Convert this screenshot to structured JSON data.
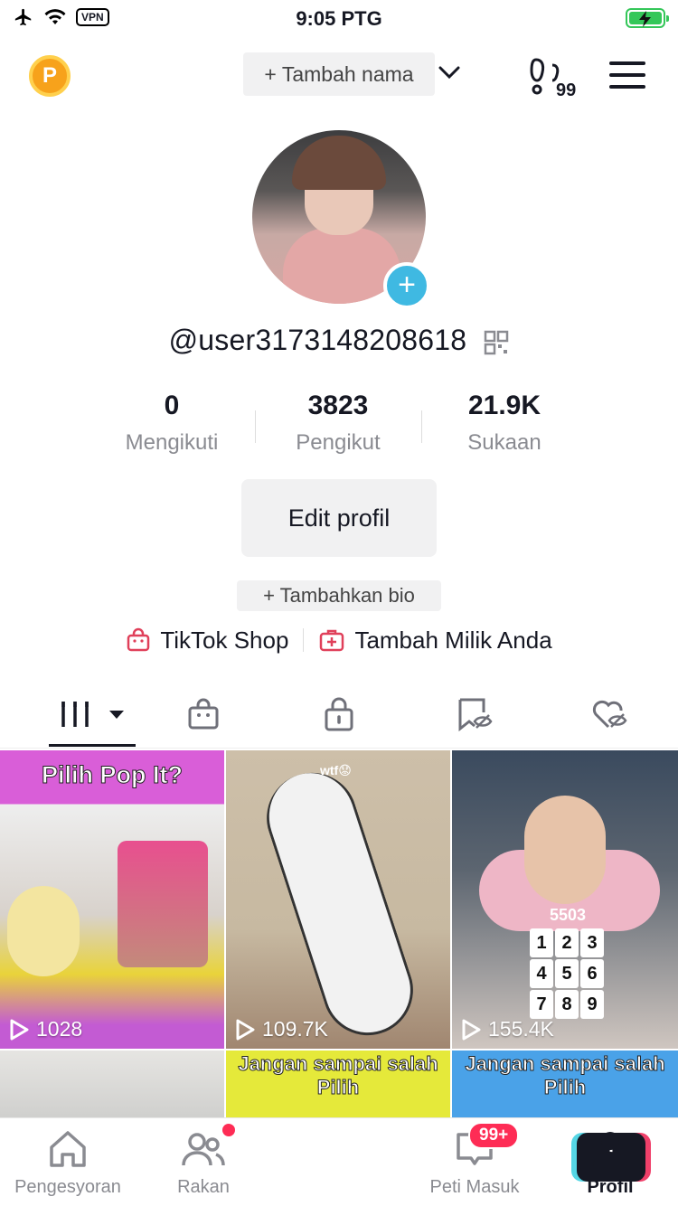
{
  "status_bar": {
    "time": "9:05 PTG",
    "vpn_label": "VPN"
  },
  "header": {
    "coin_label": "P",
    "add_name_label": "+ Tambah nama",
    "steps_badge": "99"
  },
  "profile": {
    "username": "@user3173148208618",
    "stats": [
      {
        "value": "0",
        "label": "Mengikuti"
      },
      {
        "value": "3823",
        "label": "Pengikut"
      },
      {
        "value": "21.9K",
        "label": "Sukaan"
      }
    ],
    "edit_button": "Edit profil",
    "add_bio": "+ Tambahkan bio",
    "links": {
      "shop": "TikTok Shop",
      "add_own": "Tambah Milik Anda"
    }
  },
  "videos": [
    {
      "caption": "Pilih Pop It?",
      "views": "1028"
    },
    {
      "caption": "wtf😟",
      "views": "109.7K"
    },
    {
      "caption": "5503",
      "views": "155.4K"
    },
    {
      "caption": "",
      "views": ""
    },
    {
      "caption": "Jangan sampai salah Pilih",
      "views": ""
    },
    {
      "caption": "Jangan sampai salah Pilih",
      "views": ""
    }
  ],
  "numpad_keys": [
    "1",
    "2",
    "3",
    "4",
    "5",
    "6",
    "7",
    "8",
    "9"
  ],
  "bottom_nav": {
    "home": "Pengesyoran",
    "friends": "Rakan",
    "inbox": "Peti Masuk",
    "inbox_badge": "99+",
    "profile": "Profil"
  },
  "colors": {
    "accent": "#fe2c55",
    "avatar_add": "#3fb9e2",
    "battery": "#34c759"
  }
}
